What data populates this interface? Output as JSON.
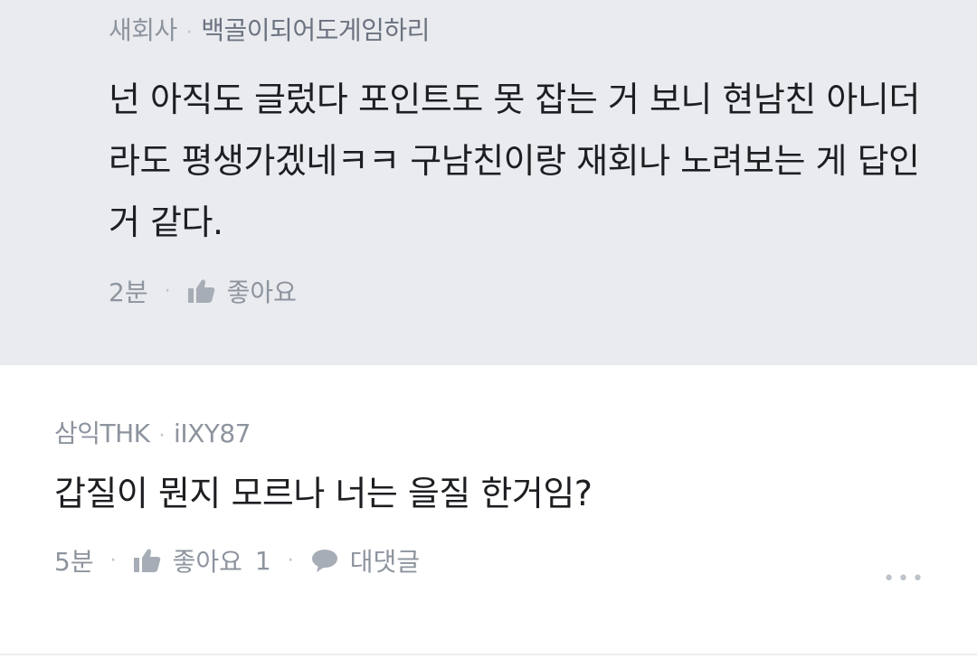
{
  "reply_comment": {
    "author_affiliation": "새회사",
    "author_name": "백골이되어도게임하리",
    "text": "넌 아직도 글렀다 포인트도 못 잡는 거 보니 현남친 아니더라도 평생가겠네ㅋㅋ 구남친이랑 재회나 노려보는 게 답인 거 같다.",
    "time": "2분",
    "like_label": "좋아요",
    "like_icon": "thumbs-up-icon"
  },
  "main_comment": {
    "author_affiliation": "삼익THK",
    "author_name": "iIXY87",
    "text": "갑질이 뭔지 모르나 너는 을질 한거임?",
    "time": "5분",
    "like_label": "좋아요",
    "like_count": "1",
    "like_icon": "thumbs-up-icon",
    "reply_label": "대댓글",
    "reply_icon": "speech-bubble-icon",
    "more_icon": "more-options-icon"
  },
  "colors": {
    "reply_background": "#e9ebee",
    "main_background": "#ffffff",
    "meta_text": "#8d949e",
    "body_text": "#1c1e21"
  }
}
